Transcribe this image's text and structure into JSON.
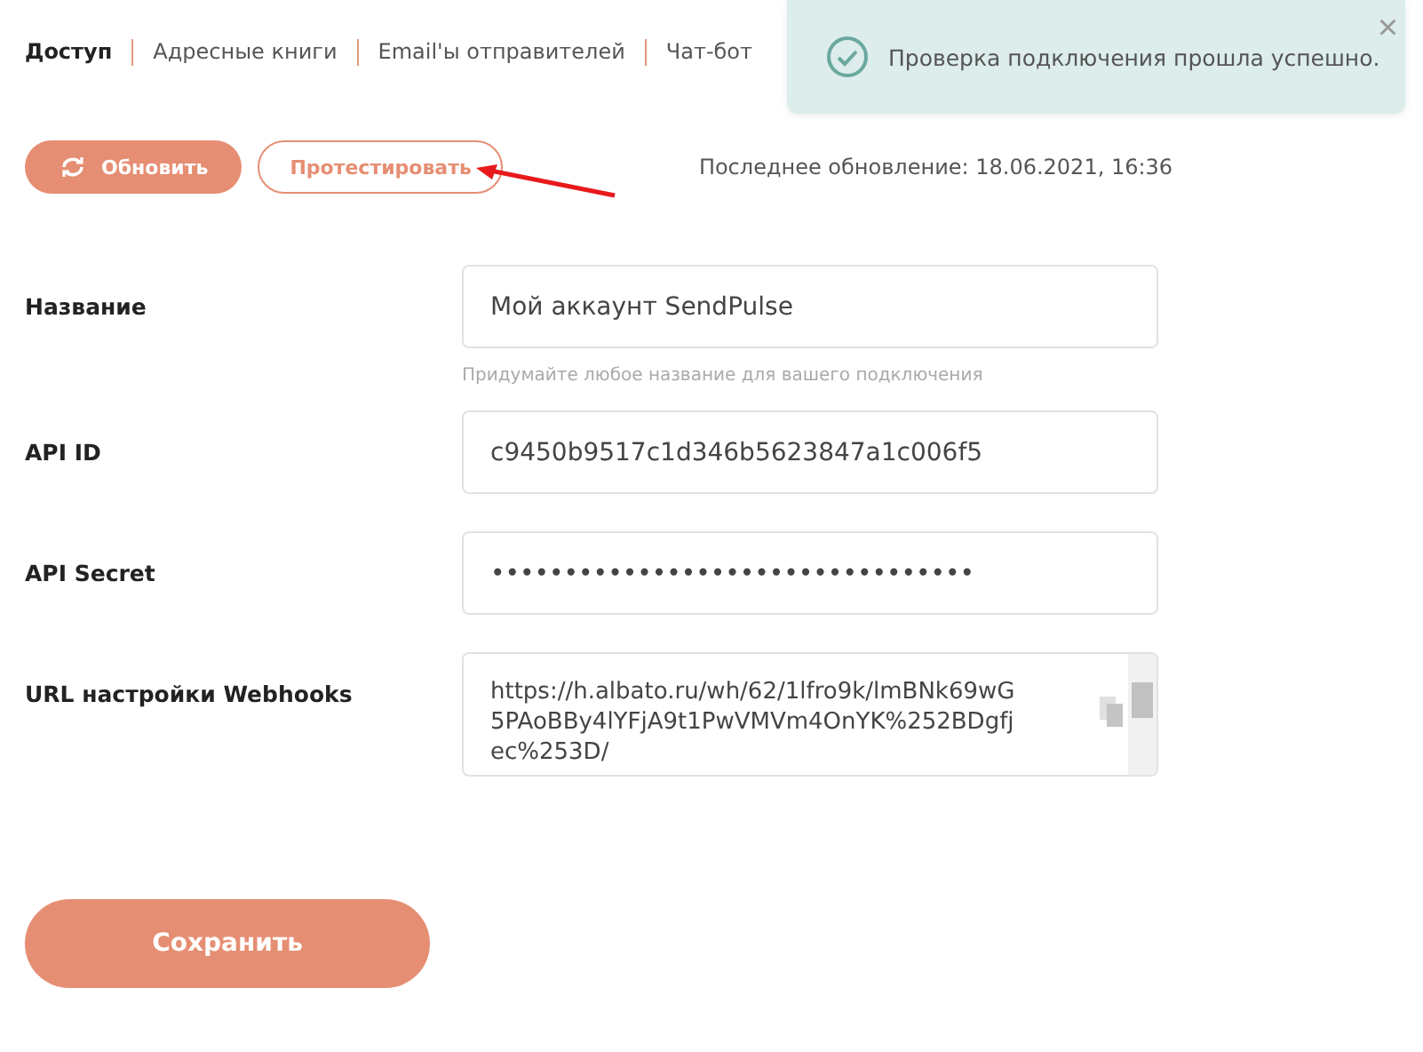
{
  "tabs": [
    {
      "label": "Доступ",
      "selected": true
    },
    {
      "label": "Адресные книги",
      "selected": false
    },
    {
      "label": "Email'ы отправителей",
      "selected": false
    },
    {
      "label": "Чат-бот",
      "selected": false
    }
  ],
  "toast": {
    "message": "Проверка подключения прошла успешно.",
    "close": "×"
  },
  "actions": {
    "refresh": "Обновить",
    "test": "Протестировать",
    "last_update": "Последнее обновление: 18.06.2021, 16:36"
  },
  "fields": [
    {
      "kind": "text",
      "label": "Название",
      "value": "Мой аккаунт SendPulse",
      "hint": "Придумайте любое название для вашего подключения"
    },
    {
      "kind": "text",
      "label": "API ID",
      "value": "c9450b9517c1d346b5623847a1c006f5"
    },
    {
      "kind": "text",
      "label": "API Secret",
      "value": "•••••••••••••••••••••••••••••••••"
    },
    {
      "kind": "textarea",
      "label": "URL настройки Webhooks",
      "value": "https://h.albato.ru/wh/62/1lfro9k/lmBNk69wG5PAoBBy4lYFjA9t1PwVMVm4OnYK%252BDgfjec%253D/"
    }
  ],
  "save": "Сохранить"
}
